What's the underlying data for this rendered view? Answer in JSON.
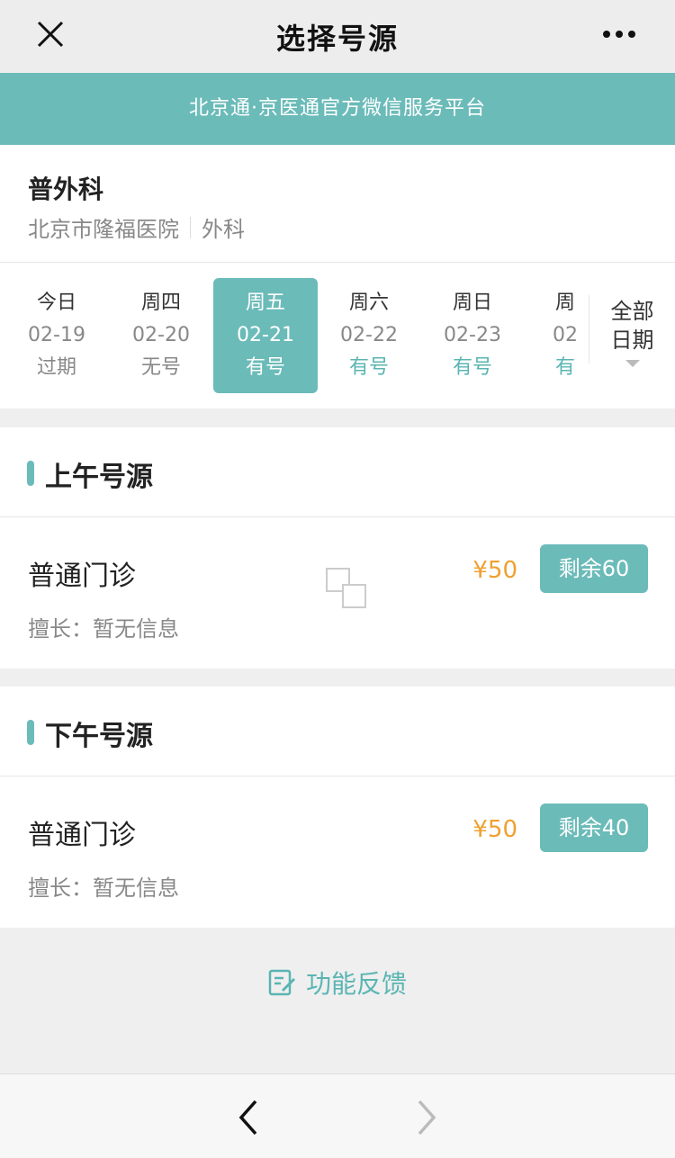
{
  "nav": {
    "title": "选择号源",
    "close_icon": "close-icon",
    "more_icon": "more-dots-icon"
  },
  "banner": {
    "text": "北京通·京医通官方微信服务平台"
  },
  "department": {
    "name": "普外科",
    "hospital": "北京市隆福医院",
    "category": "外科"
  },
  "dates": [
    {
      "weekday": "今日",
      "date": "02-19",
      "status": "过期",
      "state": "expired"
    },
    {
      "weekday": "周四",
      "date": "02-20",
      "status": "无号",
      "state": "none"
    },
    {
      "weekday": "周五",
      "date": "02-21",
      "status": "有号",
      "state": "selected"
    },
    {
      "weekday": "周六",
      "date": "02-22",
      "status": "有号",
      "state": "available"
    },
    {
      "weekday": "周日",
      "date": "02-23",
      "status": "有号",
      "state": "available"
    },
    {
      "weekday": "周",
      "date": "02",
      "status": "有",
      "state": "available"
    }
  ],
  "all_dates": {
    "line1": "全部",
    "line2": "日期"
  },
  "sections": [
    {
      "title": "上午号源",
      "slot": {
        "name": "普通门诊",
        "desc": "擅长：暂无信息",
        "price": "¥50",
        "button": "剩余60"
      }
    },
    {
      "title": "下午号源",
      "slot": {
        "name": "普通门诊",
        "desc": "擅长：暂无信息",
        "price": "¥50",
        "button": "剩余40"
      }
    }
  ],
  "feedback": {
    "label": "功能反馈"
  },
  "bottom": {
    "back_icon": "chevron-left-icon",
    "forward_icon": "chevron-right-icon"
  },
  "colors": {
    "accent": "#6bbbb9",
    "price": "#f0a030"
  }
}
